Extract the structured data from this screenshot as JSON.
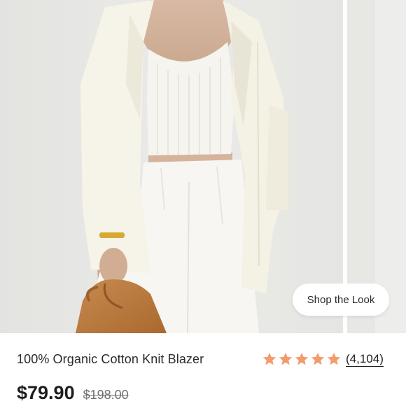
{
  "product": {
    "title": "100% Organic Cotton Knit Blazer",
    "price": "$79.90",
    "original_price": "$198.00"
  },
  "rating": {
    "stars": 5,
    "max_stars": 5,
    "review_count": "(4,104)",
    "star_color": "#F49B6B"
  },
  "gallery": {
    "shop_the_look_label": "Shop the Look"
  },
  "colors": {
    "background": "#FFFFFF",
    "text": "#1F1F1F",
    "muted_text": "#6E6E6E",
    "star": "#F49B6B"
  }
}
